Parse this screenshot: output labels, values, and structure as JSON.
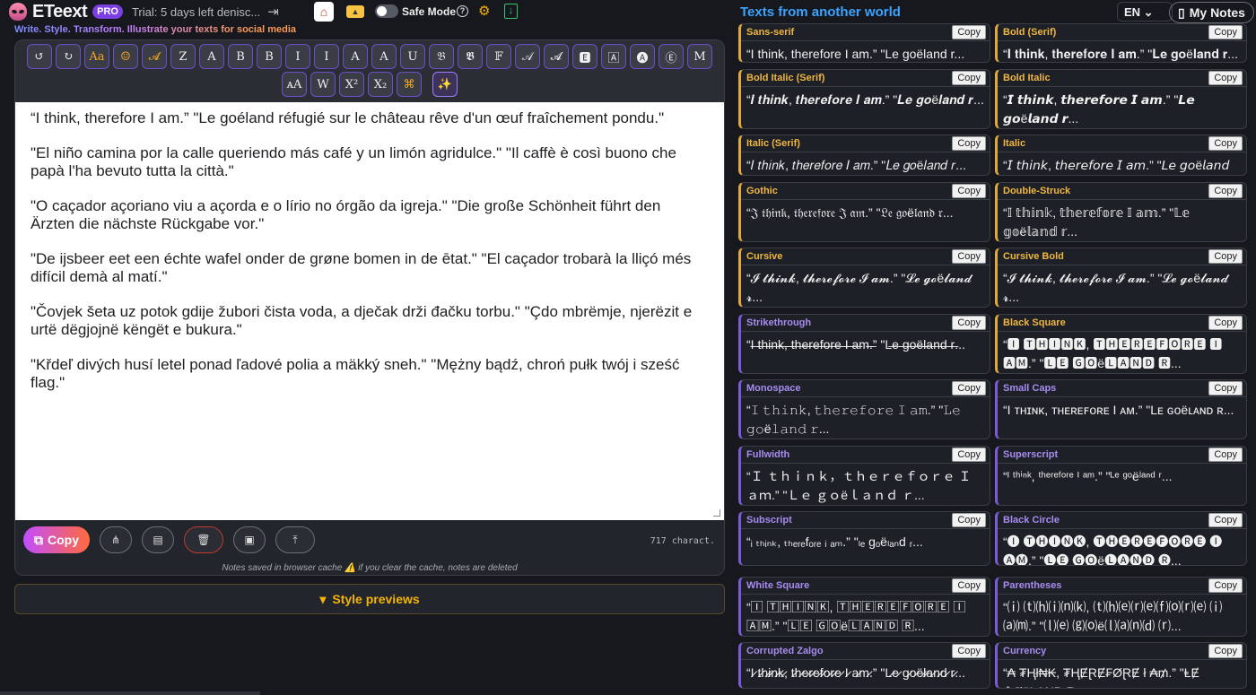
{
  "header": {
    "logo": "ETeext",
    "pro_badge": "PRO",
    "trial": "Trial: 5 days left denisc...",
    "safe_mode": "Safe Mode",
    "tagline": "Write. Style. Transform. Illustrate your texts for social media"
  },
  "toolbar": {
    "row1": [
      "↺",
      "↻",
      "Aa",
      "☺",
      "𝓐",
      "Z",
      "A",
      "B",
      "B",
      "I",
      "I",
      "A",
      "A",
      "U",
      "𝔅",
      "𝕭",
      "𝔽",
      "𝒜",
      "𝓐",
      "🅴",
      "🄰",
      "🅐",
      "Ⓔ",
      "M"
    ],
    "row2": [
      "ᴀA",
      "W",
      "X²",
      "X₂",
      "⌘",
      "✨"
    ]
  },
  "editor": {
    "paragraphs": [
      "“I think, therefore I am.” \"Le goéland réfugié sur le château rêve d'un œuf fraîchement pondu.\"",
      "\"El niño camina por la calle queriendo más café y un limón agridulce.\" \"Il caffè è così buono che papà l'ha bevuto tutta la città.\"",
      "\"O caçador açoriano viu a açorda e o lírio no órgão da igreja.\" \"Die große Schönheit führt den Ärzten die nächste Rückgabe vor.\"",
      "\"De ijsbeer eet een échte wafel onder de grøne bomen in de ētat.\" \"El caçador trobarà la lliçó més difícil demà al matí.\"",
      "\"Čovjek šeta uz potok gdije žubori čista voda, a dječak drži đačku torbu.\" \"Çdo mbrëmje, njerëzit e urtë dëgjojnë këngët e bukura.\"",
      "\"Křdeľ divých husí letel ponad ľadové polia a mäkký sneh.\" \"Mężny bądź, chroń pułk twój i sześć flag.\""
    ],
    "copy_label": "Copy",
    "char_count": "717 charact.",
    "cache_note": "Notes saved in browser cache ⚠️ if you clear the cache, notes are deleted"
  },
  "style_previews_label": "Style previews",
  "right": {
    "title": "Texts from another world",
    "lang": "EN",
    "my_notes": "My Notes",
    "copy_label": "Copy",
    "cards": [
      {
        "name": "Sans-serif",
        "text": "“I think, therefore I am.” \"Le goëland r...",
        "accent": "orange"
      },
      {
        "name": "Bold (Serif)",
        "text": "“𝐈 𝐭𝐡𝐢𝐧𝐤, 𝐭𝐡𝐞𝐫𝐞𝐟𝐨𝐫𝐞 𝐈 𝐚𝐦.” \"𝐋𝐞 𝐠𝐨ë𝐥𝐚𝐧𝐝 𝐫...",
        "accent": "orange"
      },
      {
        "name": "Bold Italic (Serif)",
        "text": "“𝑰 𝒕𝒉𝒊𝒏𝒌, 𝒕𝒉𝒆𝒓𝒆𝒇𝒐𝒓𝒆 𝑰 𝒂𝒎.” \"𝑳𝒆 𝒈𝒐ë𝒍𝒂𝒏𝒅 𝒓...",
        "accent": "orange"
      },
      {
        "name": "Bold Italic",
        "text": "“𝙄 𝙩𝙝𝙞𝙣𝙠, 𝙩𝙝𝙚𝙧𝙚𝙛𝙤𝙧𝙚 𝙄 𝙖𝙢.” \"𝙇𝙚 𝙜𝙤ë𝙡𝙖𝙣𝙙 𝙧...",
        "accent": "orange"
      },
      {
        "name": "Italic (Serif)",
        "text": "“𝐼 𝑡ℎ𝑖𝑛𝑘, 𝑡ℎ𝑒𝑟𝑒𝑓𝑜𝑟𝑒 𝐼 𝑎𝑚.” \"𝐿𝑒 𝑔𝑜ë𝑙𝑎𝑛𝑑 𝑟...",
        "accent": "orange"
      },
      {
        "name": "Italic",
        "text": "“𝘐 𝘵𝘩𝘪𝘯𝘬, 𝘵𝘩𝘦𝘳𝘦𝘧𝘰𝘳𝘦 𝘐 𝘢𝘮.” \"𝘓𝘦 𝘨𝘰ë𝘭𝘢𝘯𝘥 𝘳...",
        "accent": "orange"
      },
      {
        "name": "Gothic",
        "text": "“𝔍 𝔱𝔥𝔦𝔫𝔨, 𝔱𝔥𝔢𝔯𝔢𝔣𝔬𝔯𝔢 𝔍 𝔞𝔪.” \"𝔏𝔢 𝔤𝔬ë𝔩𝔞𝔫𝔡 𝔯...",
        "accent": "orange"
      },
      {
        "name": "Double-Struck",
        "text": "“𝕀 𝕥𝕙𝕚𝕟𝕜, 𝕥𝕙𝕖𝕣𝕖𝕗𝕠𝕣𝕖 𝕀 𝕒𝕞.” \"𝕃𝕖 𝕘𝕠ë𝕝𝕒𝕟𝕕 𝕣...",
        "accent": "orange"
      },
      {
        "name": "Cursive",
        "text": "“𝓘 𝓽𝓱𝓲𝓷𝓴, 𝓽𝓱𝓮𝓻𝓮𝓯𝓸𝓻𝓮 𝓘 𝓪𝓶.” \"𝓛𝓮 𝓰𝓸ë𝓵𝓪𝓷𝓭 𝓻...",
        "accent": "orange"
      },
      {
        "name": "Cursive Bold",
        "text": "“𝓘 𝓽𝓱𝓲𝓷𝓴, 𝓽𝓱𝓮𝓻𝓮𝓯𝓸𝓻𝓮 𝓘 𝓪𝓶.” \"𝓛𝓮 𝓰𝓸ë𝓵𝓪𝓷𝓭 𝓻...",
        "accent": "orange"
      },
      {
        "name": "Strikethrough",
        "text": "“I̶ ̶t̶h̶i̶n̶k̶,̶ ̶t̶h̶e̶r̶e̶f̶o̶r̶e̶ ̶I̶ ̶a̶m̶.̶” \"L̶e̶ ̶g̶o̶ë̶l̶a̶n̶d̶ ̶r̶...",
        "accent": "violet"
      },
      {
        "name": "Black Square",
        "text": "“🅸 🆃🅷🅸🅽🅺, 🆃🅷🅴🆁🅴🅵🅾🆁🅴 🅸 🅰🅼.” \"🅻🅴 🅶🅾ë🅻🅰🅽🅳 🆁...",
        "accent": "orange"
      },
      {
        "name": "Monospace",
        "text": "“𝙸 𝚝𝚑𝚒𝚗𝚔, 𝚝𝚑𝚎𝚛𝚎𝚏𝚘𝚛𝚎 𝙸 𝚊𝚖.” \"𝙻𝚎 𝚐𝚘ë𝚕𝚊𝚗𝚍 𝚛...",
        "accent": "violet"
      },
      {
        "name": "Small Caps",
        "text": "“I ᴛʜɪɴᴋ, ᴛʜᴇʀᴇꜰᴏʀᴇ I ᴀᴍ.” \"Lᴇ ɢᴏëʟᴀɴᴅ ʀ...",
        "accent": "violet"
      },
      {
        "name": "Fullwidth",
        "text": "“Ｉ ｔｈｉｎｋ，ｔｈｅｒｅｆｏｒｅ Ｉ ａｍ.” \"Ｌｅ ｇｏëｌａｎｄ ｒ...",
        "accent": "violet"
      },
      {
        "name": "Superscript",
        "text": "“ᴵ ᵗʰⁱⁿᵏ, ᵗʰᵉʳᵉᶠᵒʳᵉ ᴵ ᵃᵐ.” \"ᴸᵉ ᵍᵒëˡᵃⁿᵈ ʳ...",
        "accent": "violet"
      },
      {
        "name": "Subscript",
        "text": "“ᵢ ₜₕᵢₙₖ, ₜₕₑᵣₑfₒᵣₑ ᵢ ₐₘ.” \"ₗₑ gₒëₗₐₙd ᵣ...",
        "accent": "violet"
      },
      {
        "name": "Black Circle",
        "text": "“🅘 🅣🅗🅘🅝🅚, 🅣🅗🅔🅡🅔🅕🅞🅡🅔 🅘 🅐🅜.” \"🅛🅔 🅖🅞ë🅛🅐🅝🅓 🅡...",
        "accent": "violet"
      },
      {
        "name": "White Square",
        "text": "“🄸 🅃🄷🄸🄽🄺, 🅃🄷🄴🅁🄴🄵🄾🅁🄴 🄸 🄰🄼.” \"🄻🄴 🄶🄾ë🄻🄰🄽🄳 🅁...",
        "accent": "violet"
      },
      {
        "name": "Parentheses",
        "text": "“⒤ ⒯⒣⒤⒩⒦, ⒯⒣⒠⒭⒠⒡⒪⒭⒠ ⒤ ⒜⒨.” \"⒧⒠ ⒢⒪ë⒧⒜⒩⒟ ⒭...",
        "accent": "violet"
      },
      {
        "name": "Corrupted Zalgo",
        "text": "“I̷ t̷h̷i̷n̷k̷, t̷h̷e̷r̷e̷f̷o̷r̷e̷ I̷ a̷m̷.” \"L̷e̷ g̷o̷ë̷l̷a̷n̷d̷ r̷...",
        "accent": "violet"
      },
      {
        "name": "Currency",
        "text": "“₳ ₮Ⱨł₦₭, ₮ⱧɆⱤɆ₣ØⱤɆ ł ₳₥.” \"ⱠɆ ₲ØëⱠ₳₦Đ Ɽ...",
        "accent": "violet"
      }
    ]
  }
}
